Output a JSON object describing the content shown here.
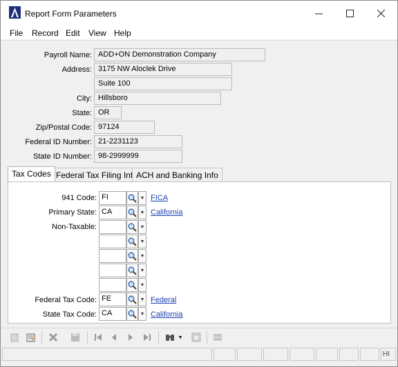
{
  "window": {
    "title": "Report Form Parameters",
    "minimize_symbol": "—",
    "maximize_symbol": "☐",
    "close_symbol": "✕"
  },
  "menu": [
    "File",
    "Record",
    "Edit",
    "View",
    "Help"
  ],
  "form": {
    "payroll_name": {
      "label": "Payroll Name:",
      "value": "ADD+ON Demonstration Company"
    },
    "address": {
      "label": "Address:",
      "line1": "3175 NW Aloclek Drive",
      "line2": "Suite 100"
    },
    "city": {
      "label": "City:",
      "value": "Hillsboro"
    },
    "state": {
      "label": "State:",
      "value": "OR"
    },
    "zip": {
      "label": "Zip/Postal Code:",
      "value": "97124"
    },
    "federal_id": {
      "label": "Federal ID Number:",
      "value": "21-2231123"
    },
    "state_id": {
      "label": "State ID Number:",
      "value": "98-2999999"
    }
  },
  "tabs": [
    "Tax Codes",
    "Federal Tax Filing Info",
    "ACH and Banking Info"
  ],
  "tax_codes": {
    "code_941": {
      "label": "941 Code:",
      "value": "FI",
      "link": "FICA"
    },
    "primary_state": {
      "label": "Primary State:",
      "value": "CA",
      "link": "California"
    },
    "non_taxable": {
      "label": "Non-Taxable:",
      "values": [
        "",
        "",
        "",
        "",
        ""
      ]
    },
    "federal_tax_code": {
      "label": "Federal Tax Code:",
      "value": "FE",
      "link": "Federal"
    },
    "state_tax_code": {
      "label": "State Tax Code:",
      "value": "CA",
      "link": "California"
    }
  },
  "status": {
    "last_cell": "HI"
  },
  "icons": {
    "lookup": "magnifier-icon",
    "dropdown": "chevron-down-icon"
  }
}
